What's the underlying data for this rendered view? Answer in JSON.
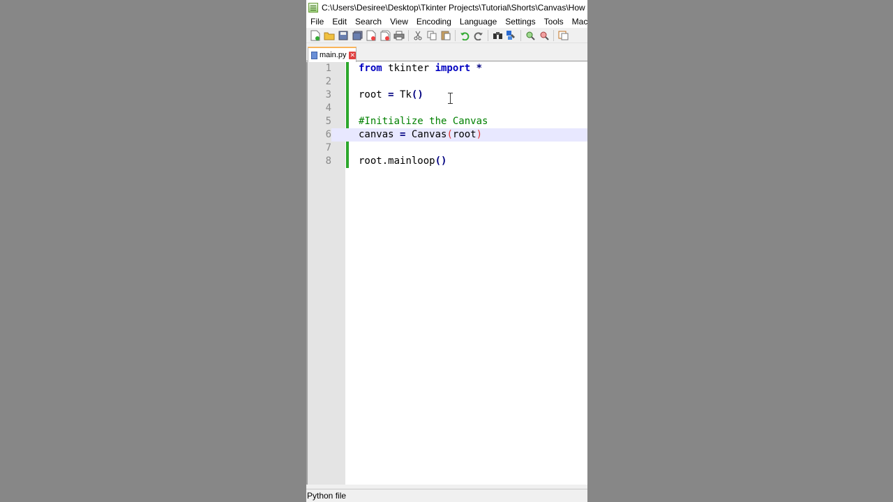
{
  "window": {
    "title": "C:\\Users\\Desiree\\Desktop\\Tkinter Projects\\Tutorial\\Shorts\\Canvas\\How to Cr"
  },
  "menu": [
    "File",
    "Edit",
    "Search",
    "View",
    "Encoding",
    "Language",
    "Settings",
    "Tools",
    "Macro"
  ],
  "toolbar": {
    "icons": [
      "new-icon",
      "open-icon",
      "save-icon",
      "save-all-icon",
      "close-icon",
      "close-all-icon",
      "print-icon",
      "cut-icon",
      "copy-icon",
      "paste-icon",
      "undo-icon",
      "redo-icon",
      "find-icon",
      "replace-icon",
      "zoom-in-icon",
      "zoom-out-icon",
      "sync-icon"
    ]
  },
  "tab": {
    "label": "main.py",
    "close_glyph": "✕"
  },
  "editor": {
    "line_numbers": [
      "1",
      "2",
      "3",
      "4",
      "5",
      "6",
      "7",
      "8"
    ],
    "lines": [
      {
        "k1": "from",
        "t1": " tkinter ",
        "k2": "import",
        "t2": " ",
        "o1": "*"
      },
      {},
      {
        "t1": "root ",
        "o1": "=",
        "t2": " Tk",
        "o2": "()"
      },
      {},
      {
        "c1": "#Initialize the Canvas"
      },
      {
        "t1": "canvas ",
        "o1": "=",
        "t2": " Canvas",
        "b1": "(",
        "t3": "root",
        "b2": ")"
      },
      {},
      {
        "t1": "root",
        "o1": ".",
        "t2": "mainloop",
        "o2": "()"
      }
    ],
    "current_line": "6"
  },
  "status": {
    "file_type": "Python file"
  },
  "colors": {
    "keyword": "#0000c0",
    "comment": "#008000",
    "brace_match": "#e03030",
    "change_bar": "#2ca72c",
    "current_line": "#e8e8ff",
    "background_outside": "#878787"
  }
}
